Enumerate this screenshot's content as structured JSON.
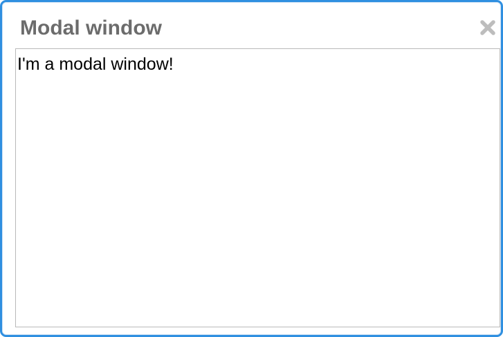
{
  "modal": {
    "title": "Modal window",
    "body_text": "I'm a modal window!",
    "close_icon": "close-icon",
    "border_color": "#2f8fe0",
    "title_color": "#6c6c6c"
  }
}
